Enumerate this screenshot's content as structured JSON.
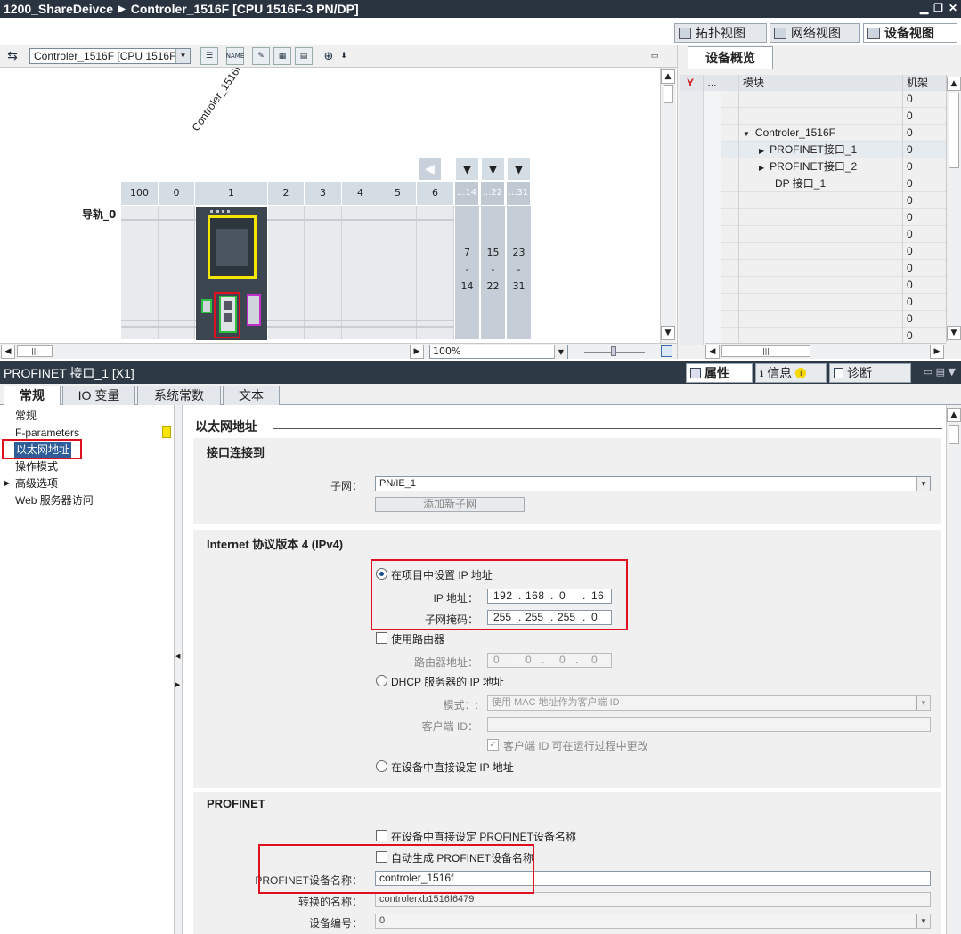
{
  "titlebar": {
    "project": "1200_ShareDeivce",
    "device": "Controler_1516F [CPU 1516F-3 PN/DP]"
  },
  "view_tabs": [
    {
      "label": "拓扑视图"
    },
    {
      "label": "网络视图"
    },
    {
      "label": "设备视图"
    }
  ],
  "device_select": {
    "value": "Controler_1516F [CPU 1516F-"
  },
  "toolbar": {
    "name_label": "NAME"
  },
  "canvas": {
    "device_label": "Controler_1516F",
    "rail_label": "导轨_0",
    "slots": [
      "100",
      "0",
      "1",
      "2",
      "3",
      "4",
      "5",
      "6"
    ],
    "rack_headers": [
      "...14",
      "...22",
      "...31"
    ],
    "rack_cols": [
      {
        "top": "7",
        "mid": "-",
        "bottom": "14"
      },
      {
        "top": "15",
        "mid": "-",
        "bottom": "22"
      },
      {
        "top": "23",
        "mid": "-",
        "bottom": "31"
      }
    ],
    "zoom": "100%"
  },
  "overview": {
    "tab": "设备概览",
    "headers": {
      "dots": "...",
      "module": "模块",
      "rack": "机架"
    },
    "rows": [
      {
        "module": "",
        "rack": "0",
        "expand": ""
      },
      {
        "module": "",
        "rack": "0",
        "expand": ""
      },
      {
        "module": "Controler_1516F",
        "rack": "0",
        "expand": "▼"
      },
      {
        "module": "PROFINET接口_1",
        "rack": "0",
        "expand": "▶"
      },
      {
        "module": "PROFINET接口_2",
        "rack": "0",
        "expand": "▶"
      },
      {
        "module": "DP 接口_1",
        "rack": "0",
        "expand": ""
      },
      {
        "module": "",
        "rack": "0",
        "expand": ""
      },
      {
        "module": "",
        "rack": "0",
        "expand": ""
      },
      {
        "module": "",
        "rack": "0",
        "expand": ""
      },
      {
        "module": "",
        "rack": "0",
        "expand": ""
      },
      {
        "module": "",
        "rack": "0",
        "expand": ""
      },
      {
        "module": "",
        "rack": "0",
        "expand": ""
      },
      {
        "module": "",
        "rack": "0",
        "expand": ""
      },
      {
        "module": "",
        "rack": "0",
        "expand": ""
      },
      {
        "module": "",
        "rack": "0",
        "expand": ""
      }
    ]
  },
  "properties": {
    "title": "PROFINET 接口_1 [X1]",
    "tabs": [
      "属性",
      "信息",
      "诊断"
    ]
  },
  "main_tabs": [
    "常规",
    "IO 变量",
    "系统常数",
    "文本"
  ],
  "nav": [
    {
      "label": "常规"
    },
    {
      "label": "F-parameters"
    },
    {
      "label": "以太网地址"
    },
    {
      "label": "操作模式"
    },
    {
      "label": "高级选项"
    },
    {
      "label": "Web 服务器访问"
    }
  ],
  "form": {
    "section_title": "以太网地址",
    "interface": {
      "title": "接口连接到",
      "subnet_label": "子网：",
      "subnet_value": "PN/IE_1",
      "add_subnet": "添加新子网"
    },
    "ipv4": {
      "title": "Internet 协议版本 4 (IPv4)",
      "opt_project": "在项目中设置 IP 地址",
      "ip_label": "IP 地址：",
      "ip": [
        "192",
        "168",
        "0",
        "16"
      ],
      "mask_label": "子网掩码：",
      "mask": [
        "255",
        "255",
        "255",
        "0"
      ],
      "use_router": "使用路由器",
      "router_label": "路由器地址：",
      "router": [
        "0",
        "0",
        "0",
        "0"
      ],
      "opt_dhcp": "DHCP 服务器的 IP 地址",
      "mode_label": "模式：:",
      "mode_value": "使用 MAC 地址作为客户端 ID",
      "client_id_label": "客户端 ID：",
      "client_change": "客户端 ID 可在运行过程中更改",
      "opt_device": "在设备中直接设定 IP 地址"
    },
    "profinet": {
      "title": "PROFINET",
      "opt_set_in_device": "在设备中直接设定 PROFINET设备名称",
      "opt_auto": "自动生成 PROFINET设备名称",
      "name_label": "PROFINET设备名称：",
      "name_value": "controler_1516f",
      "converted_label": "转换的名称：",
      "converted_value": "controlerxb1516f6479",
      "number_label": "设备编号：",
      "number_value": "0"
    }
  },
  "colors": {
    "title_bg": "#2a3440",
    "highlight_red": "#e01020",
    "nav_selected": "#2f5d9a"
  }
}
